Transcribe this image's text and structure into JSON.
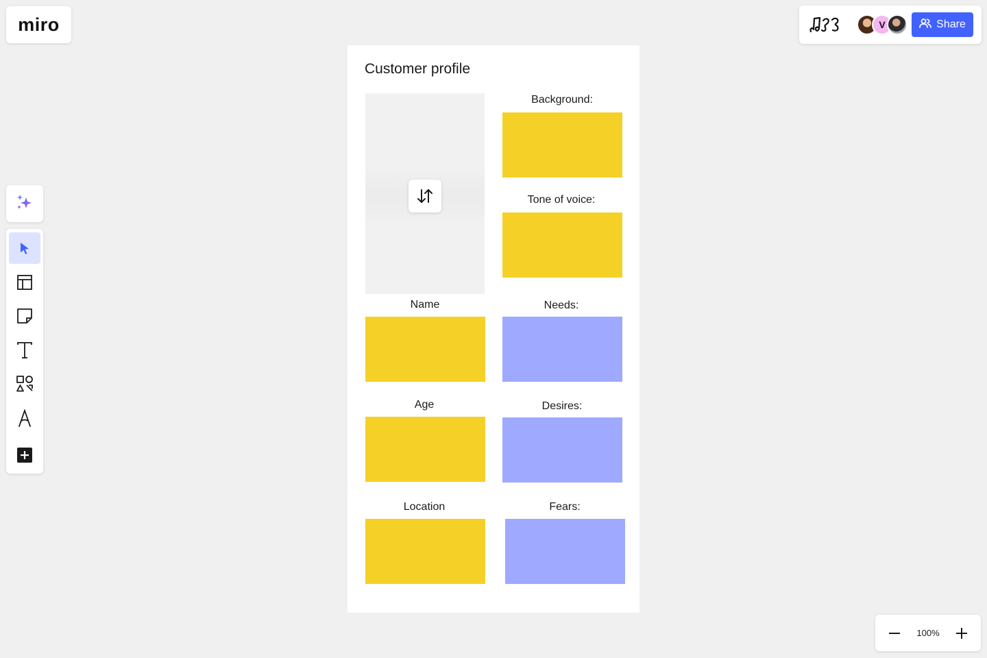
{
  "app": {
    "logo": "miro"
  },
  "header": {
    "share_label": "Share",
    "collaborators": [
      {
        "initial": ""
      },
      {
        "initial": "V"
      },
      {
        "initial": ""
      }
    ]
  },
  "toolbar": {
    "tools": [
      "ai-icon",
      "select-icon",
      "templates-icon",
      "sticky-note-icon",
      "text-icon",
      "shapes-icon",
      "pen-icon",
      "more-apps-icon"
    ]
  },
  "zoom": {
    "level": "100%"
  },
  "frame": {
    "title": "Customer profile",
    "left_column": [
      {
        "label": "Name"
      },
      {
        "label": "Age"
      },
      {
        "label": "Location"
      }
    ],
    "right_column": [
      {
        "label": "Background:"
      },
      {
        "label": "Tone of voice:"
      },
      {
        "label": "Needs:"
      },
      {
        "label": "Desires:"
      },
      {
        "label": "Fears:"
      }
    ]
  },
  "colors": {
    "accent": "#4262ff",
    "sticky_yellow": "#f5d128",
    "sticky_blue": "#9ea9ff",
    "canvas": "#f0f0f0"
  }
}
